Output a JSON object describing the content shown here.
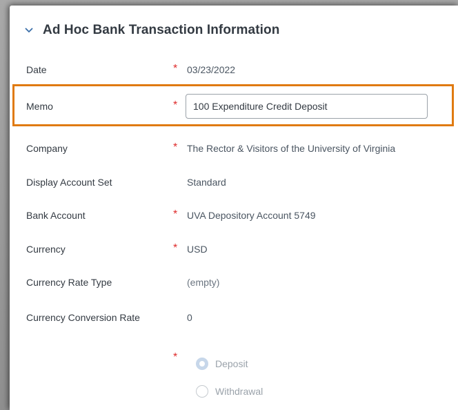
{
  "section": {
    "title": "Ad Hoc Bank Transaction Information",
    "toggle_icon": "chevron-down-icon"
  },
  "fields": {
    "date": {
      "label": "Date",
      "required": "*",
      "value": "03/23/2022"
    },
    "memo": {
      "label": "Memo",
      "required": "*",
      "value": "100 Expenditure Credit Deposit"
    },
    "company": {
      "label": "Company",
      "required": "*",
      "value": "The Rector & Visitors of the University of Virginia"
    },
    "display_account_set": {
      "label": "Display Account Set",
      "value": "Standard"
    },
    "bank_account": {
      "label": "Bank Account",
      "required": "*",
      "value": "UVA Depository Account 5749"
    },
    "currency": {
      "label": "Currency",
      "required": "*",
      "value": "USD"
    },
    "currency_rate_type": {
      "label": "Currency Rate Type",
      "value": "(empty)"
    },
    "currency_conversion_rate": {
      "label": "Currency Conversion Rate",
      "value": "0"
    }
  },
  "transaction_type": {
    "required": "*",
    "options": [
      {
        "label": "Deposit",
        "selected": true
      },
      {
        "label": "Withdrawal",
        "selected": false
      }
    ]
  },
  "colors": {
    "required": "#de2b2b",
    "highlight": "#e07a10",
    "text": "#333a42",
    "muted": "#9aa2aa"
  }
}
